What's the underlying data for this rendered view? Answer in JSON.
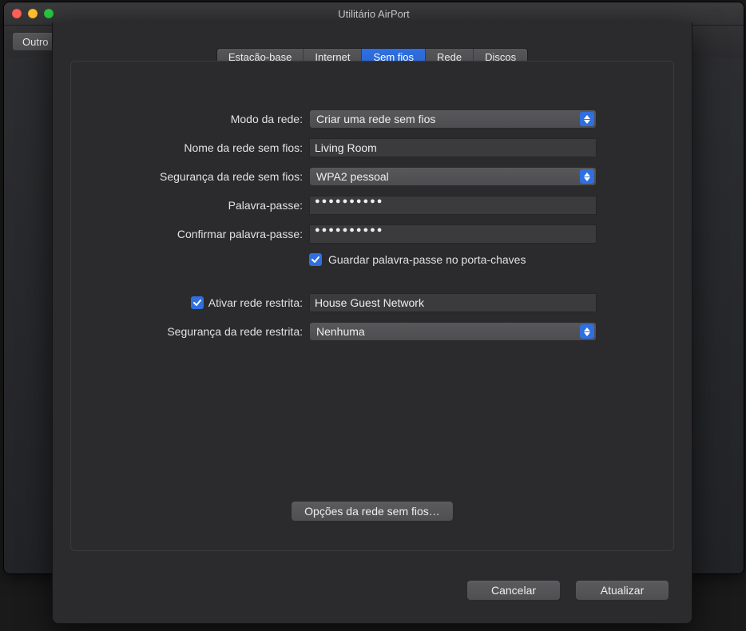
{
  "window": {
    "title": "Utilitário AirPort"
  },
  "toolbar": {
    "other_button": "Outro"
  },
  "tabs": {
    "items": [
      {
        "label": "Estação-base",
        "active": false
      },
      {
        "label": "Internet",
        "active": false
      },
      {
        "label": "Sem fios",
        "active": true
      },
      {
        "label": "Rede",
        "active": false
      },
      {
        "label": "Discos",
        "active": false
      }
    ]
  },
  "form": {
    "network_mode": {
      "label": "Modo da rede:",
      "value": "Criar uma rede sem fios"
    },
    "network_name": {
      "label": "Nome da rede sem fios:",
      "value": "Living Room"
    },
    "security": {
      "label": "Segurança da rede sem fios:",
      "value": "WPA2 pessoal"
    },
    "password": {
      "label": "Palavra-passe:",
      "masked": "●●●●●●●●●●"
    },
    "confirm_password": {
      "label": "Confirmar palavra-passe:",
      "masked": "●●●●●●●●●●"
    },
    "keychain": {
      "label": "Guardar palavra-passe no porta-chaves",
      "checked": true
    },
    "guest_enable": {
      "label": "Ativar rede restrita:",
      "checked": true,
      "value": "House Guest Network"
    },
    "guest_security": {
      "label": "Segurança da rede restrita:",
      "value": "Nenhuma"
    },
    "options_button": "Opções da rede sem fios…"
  },
  "footer": {
    "cancel": "Cancelar",
    "update": "Atualizar"
  }
}
